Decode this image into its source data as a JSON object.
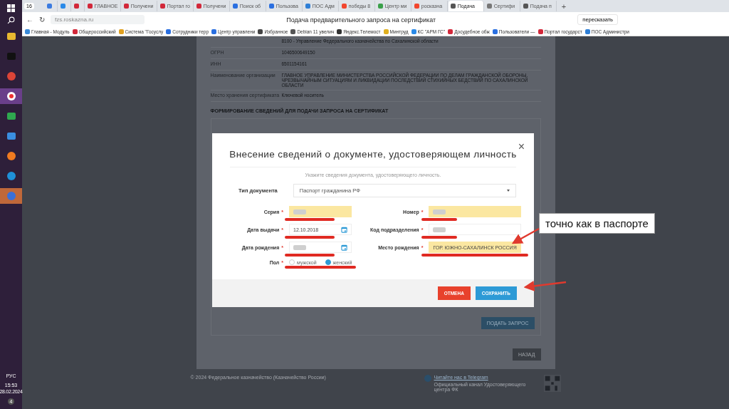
{
  "taskbar": {
    "apps": [
      {
        "kind": "folder",
        "selected": false,
        "hovered": false
      },
      {
        "kind": "terminal",
        "selected": false,
        "hovered": false
      },
      {
        "kind": "chrome",
        "selected": false,
        "hovered": false
      },
      {
        "kind": "yandex",
        "selected": false,
        "hovered": true
      },
      {
        "kind": "chat",
        "selected": false,
        "hovered": false
      },
      {
        "kind": "store",
        "selected": false,
        "hovered": false
      },
      {
        "kind": "firefox",
        "selected": false,
        "hovered": false
      },
      {
        "kind": "edge",
        "selected": false,
        "hovered": false
      },
      {
        "kind": "swoosh",
        "selected": true,
        "hovered": false
      }
    ],
    "language": "РУС",
    "time": "15:53",
    "date": "28.02.2024",
    "notifications": "4"
  },
  "browser": {
    "tab_count": "16",
    "tabs": [
      {
        "color": "#3b7be0",
        "selected": false
      },
      {
        "color": "#2a8ae8",
        "selected": false
      },
      {
        "color": "#d2283a",
        "selected": false
      },
      {
        "title": "ГЛАВНОЕ",
        "color": "#d2283a",
        "selected": false
      },
      {
        "title": "Получени",
        "color": "#d2283a",
        "selected": false
      },
      {
        "title": "Портал го",
        "color": "#d2283a",
        "selected": false
      },
      {
        "title": "Получени",
        "color": "#d2283a",
        "selected": false
      },
      {
        "title": "Поиск об",
        "color": "#2a6fe0",
        "selected": false
      },
      {
        "title": "Пользова",
        "color": "#2a6fe0",
        "selected": false
      },
      {
        "title": "ПОС Адм",
        "color": "#2f7fd6",
        "selected": false
      },
      {
        "title": "победы 8",
        "color": "#f2462e",
        "selected": false
      },
      {
        "title": "Центр ми",
        "color": "#3aa04a",
        "selected": false
      },
      {
        "title": "росказна",
        "color": "#f2462e",
        "selected": false
      },
      {
        "title": "Подача",
        "color": "#555555",
        "selected": true
      },
      {
        "title": "Сертифи",
        "color": "#777777",
        "selected": false
      },
      {
        "title": "Подача п",
        "color": "#555555",
        "selected": false
      }
    ],
    "new_tab": "+",
    "back": "←",
    "reload": "↻",
    "url": "fzs.roskazna.ru",
    "page_title": "Подача предварительного запроса на сертификат",
    "retell_button": "пересказать",
    "bookmarks": [
      {
        "label": "Главная - Модуль",
        "color": "#3a8ad8"
      },
      {
        "label": "Общероссийский",
        "color": "#d2283a"
      },
      {
        "label": "Система \"Госуслу",
        "color": "#e0a020"
      },
      {
        "label": "Сотрудники терр",
        "color": "#2a6fe0"
      },
      {
        "label": "Центр управлени",
        "color": "#2a6fe0"
      },
      {
        "label": "Избранное",
        "color": "#444444"
      },
      {
        "label": "Debian 11 увелич",
        "color": "#555555"
      },
      {
        "label": "Яндекс.Телемост",
        "color": "#333333"
      },
      {
        "label": "Минтруд",
        "color": "#e0b020"
      },
      {
        "label": "КС \"АРМ ГС\"",
        "color": "#2a8ae8"
      },
      {
        "label": "Досудебное обж",
        "color": "#d2283a"
      },
      {
        "label": "Пользователи —",
        "color": "#2a6fe0"
      },
      {
        "label": "Портал государст",
        "color": "#d2283a"
      },
      {
        "label": "ПОС Администри",
        "color": "#2f7fd6"
      }
    ]
  },
  "page": {
    "info_rows": [
      {
        "value": "8100 - Управление Федерального казначейства по Сахалинской области"
      },
      {
        "label": "ОГРН",
        "value": "1046500649150"
      },
      {
        "label": "ИНН",
        "value": "6501154161"
      },
      {
        "label": "Наименование организации",
        "value": "ГЛАВНОЕ УПРАВЛЕНИЕ МИНИСТЕРСТВА РОССИЙСКОЙ ФЕДЕРАЦИИ ПО ДЕЛАМ ГРАЖДАНСКОЙ ОБОРОНЫ, ЧРЕЗВЫЧАЙНЫМ СИТУАЦИЯМ И ЛИКВИДАЦИИ ПОСЛЕДСТВИЙ СТИХИЙНЫХ БЕДСТВИЙ ПО САХАЛИНСКОЙ ОБЛАСТИ"
      },
      {
        "label": "Место хранения сертификата",
        "value": "Ключевой носитель"
      }
    ],
    "section_title": "ФОРМИРОВАНИЕ СВЕДЕНИЙ ДЛЯ ПОДАЧИ ЗАПРОСА НА СЕРТИФИКАТ",
    "submit_button": "ПОДАТЬ ЗАПРОС",
    "back_button": "НАЗАД",
    "copyright": "© 2024 Федеральное казначейство (Казначейство России)",
    "telegram_link": "Читайте нас в Telegram",
    "telegram_caption": "Официальный канал Удостоверяющего центра ФК"
  },
  "dialog": {
    "title": "Внесение сведений о документе, удостоверяющем личность",
    "close": "×",
    "hint": "Укажите сведения документа, удостоверяющего личность.",
    "required_mark": "*",
    "doc_type": {
      "label": "Тип документа",
      "value": "Паспорт гражданина РФ"
    },
    "left_fields": [
      {
        "label": "Серия",
        "kind": "text",
        "required": true,
        "highlighted": true,
        "redacted": true
      },
      {
        "label": "Дата выдачи",
        "kind": "date",
        "required": true,
        "highlighted": false,
        "value": "12.10.2018"
      },
      {
        "label": "Дата рождения",
        "kind": "date",
        "required": true,
        "highlighted": false,
        "redacted": true
      }
    ],
    "right_fields": [
      {
        "label": "Номер",
        "kind": "text",
        "required": true,
        "highlighted": true,
        "redacted": true
      },
      {
        "label": "Код подразделения",
        "kind": "text",
        "required": true,
        "highlighted": false,
        "redacted": true
      },
      {
        "label": "Место рождения",
        "kind": "text",
        "required": true,
        "highlighted": true,
        "value": "ГОР. ЮЖНО-САХАЛИНСК РОССИЯ"
      }
    ],
    "gender": {
      "label": "Пол",
      "required": true,
      "options": [
        {
          "label": "мужской",
          "selected": false
        },
        {
          "label": "женский",
          "selected": true
        }
      ]
    },
    "cancel_button": "ОТМЕНА",
    "save_button": "СОХРАНИТЬ"
  },
  "annotation": {
    "callout": "точно как в паспорте"
  }
}
